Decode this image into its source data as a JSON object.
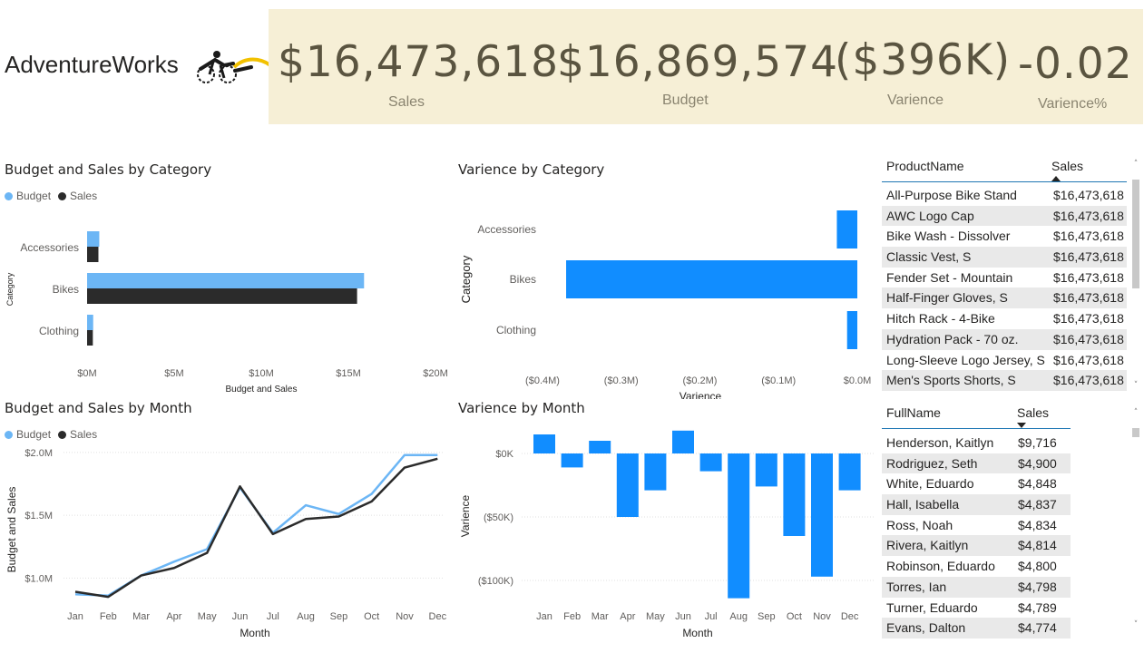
{
  "brand": {
    "name": "AdventureWorks",
    "logo_icon": "cyclist-logo-icon"
  },
  "kpis": [
    {
      "value": "$16,473,618",
      "label": "Sales"
    },
    {
      "value": "$16,869,574",
      "label": "Budget"
    },
    {
      "value": "($396K)",
      "label": "Varience"
    },
    {
      "value": "-0.02",
      "label": "Varience%"
    }
  ],
  "colors": {
    "budget": "#6cb6f5",
    "sales": "#2b2b2b",
    "variance": "#118dff",
    "kpi_band": "#f6efd6"
  },
  "budget_sales_category": {
    "title": "Budget and Sales by Category",
    "legend": {
      "budget": "Budget",
      "sales": "Sales"
    },
    "ylabel": "Category",
    "xlabel": "Budget and Sales",
    "xticks": [
      "$0M",
      "$5M",
      "$10M",
      "$15M",
      "$20M"
    ]
  },
  "variance_category": {
    "title": "Varience by Category",
    "ylabel": "Category",
    "xlabel": "Varience",
    "xticks": [
      "($0.4M)",
      "($0.3M)",
      "($0.2M)",
      "($0.1M)",
      "$0.0M"
    ]
  },
  "budget_sales_month": {
    "title": "Budget and Sales by Month",
    "legend": {
      "budget": "Budget",
      "sales": "Sales"
    },
    "ylabel": "Budget and Sales",
    "xlabel": "Month",
    "yticks": [
      "$1.0M",
      "$1.5M",
      "$2.0M"
    ]
  },
  "variance_month": {
    "title": "Varience by Month",
    "ylabel": "Varience",
    "xlabel": "Month",
    "yticks": [
      "$0K",
      "($50K)",
      "($100K)"
    ]
  },
  "chart_data": [
    {
      "type": "bar",
      "orientation": "horizontal",
      "title": "Budget and Sales by Category",
      "categories": [
        "Accessories",
        "Bikes",
        "Clothing"
      ],
      "series": [
        {
          "name": "Budget",
          "values": [
            0.7,
            15.9,
            0.35
          ]
        },
        {
          "name": "Sales",
          "values": [
            0.65,
            15.5,
            0.33
          ]
        }
      ],
      "units": "$M",
      "xlim": [
        0,
        20
      ],
      "xlabel": "Budget and Sales",
      "ylabel": "Category",
      "legend": "top-left"
    },
    {
      "type": "bar",
      "orientation": "horizontal",
      "title": "Varience by Category",
      "categories": [
        "Accessories",
        "Bikes",
        "Clothing"
      ],
      "values": [
        -0.026,
        -0.37,
        -0.013
      ],
      "units": "$M",
      "xlim": [
        -0.4,
        0
      ],
      "xlabel": "Varience",
      "ylabel": "Category"
    },
    {
      "type": "line",
      "title": "Budget and Sales by Month",
      "categories": [
        "Jan",
        "Feb",
        "Mar",
        "Apr",
        "May",
        "Jun",
        "Jul",
        "Aug",
        "Sep",
        "Oct",
        "Nov",
        "Dec"
      ],
      "series": [
        {
          "name": "Budget",
          "values": [
            0.87,
            0.86,
            1.02,
            1.13,
            1.23,
            1.72,
            1.36,
            1.58,
            1.51,
            1.67,
            1.98,
            1.98
          ]
        },
        {
          "name": "Sales",
          "values": [
            0.89,
            0.85,
            1.02,
            1.08,
            1.2,
            1.73,
            1.35,
            1.47,
            1.49,
            1.61,
            1.88,
            1.95
          ]
        }
      ],
      "units": "$M",
      "ylim": [
        0.8,
        2.05
      ],
      "xlabel": "Month",
      "ylabel": "Budget and Sales",
      "legend": "top-left"
    },
    {
      "type": "bar",
      "title": "Varience by Month",
      "categories": [
        "Jan",
        "Feb",
        "Mar",
        "Apr",
        "May",
        "Jun",
        "Jul",
        "Aug",
        "Sep",
        "Oct",
        "Nov",
        "Dec"
      ],
      "values": [
        15,
        -11,
        10,
        -50,
        -29,
        18,
        -14,
        -114,
        -26,
        -65,
        -97,
        -29
      ],
      "units": "$K",
      "ylim": [
        -115,
        20
      ],
      "xlabel": "Month",
      "ylabel": "Varience"
    }
  ],
  "product_table": {
    "headers": [
      "ProductName",
      "Sales"
    ],
    "rows": [
      [
        "All-Purpose Bike Stand",
        "$16,473,618"
      ],
      [
        "AWC Logo Cap",
        "$16,473,618"
      ],
      [
        "Bike Wash - Dissolver",
        "$16,473,618"
      ],
      [
        "Classic Vest, S",
        "$16,473,618"
      ],
      [
        "Fender Set - Mountain",
        "$16,473,618"
      ],
      [
        "Half-Finger Gloves, S",
        "$16,473,618"
      ],
      [
        "Hitch Rack - 4-Bike",
        "$16,473,618"
      ],
      [
        "Hydration Pack - 70 oz.",
        "$16,473,618"
      ],
      [
        "Long-Sleeve Logo Jersey, S",
        "$16,473,618"
      ],
      [
        "Men's Sports Shorts, S",
        "$16,473,618"
      ]
    ]
  },
  "customer_table": {
    "headers": [
      "FullName",
      "Sales"
    ],
    "rows": [
      [
        "Henderson, Kaitlyn",
        "$9,716"
      ],
      [
        "Rodriguez, Seth",
        "$4,900"
      ],
      [
        "White, Eduardo",
        "$4,848"
      ],
      [
        "Hall, Isabella",
        "$4,837"
      ],
      [
        "Ross, Noah",
        "$4,834"
      ],
      [
        "Rivera, Kaitlyn",
        "$4,814"
      ],
      [
        "Robinson, Eduardo",
        "$4,800"
      ],
      [
        "Torres, Ian",
        "$4,798"
      ],
      [
        "Turner, Eduardo",
        "$4,789"
      ],
      [
        "Evans, Dalton",
        "$4,774"
      ]
    ]
  }
}
